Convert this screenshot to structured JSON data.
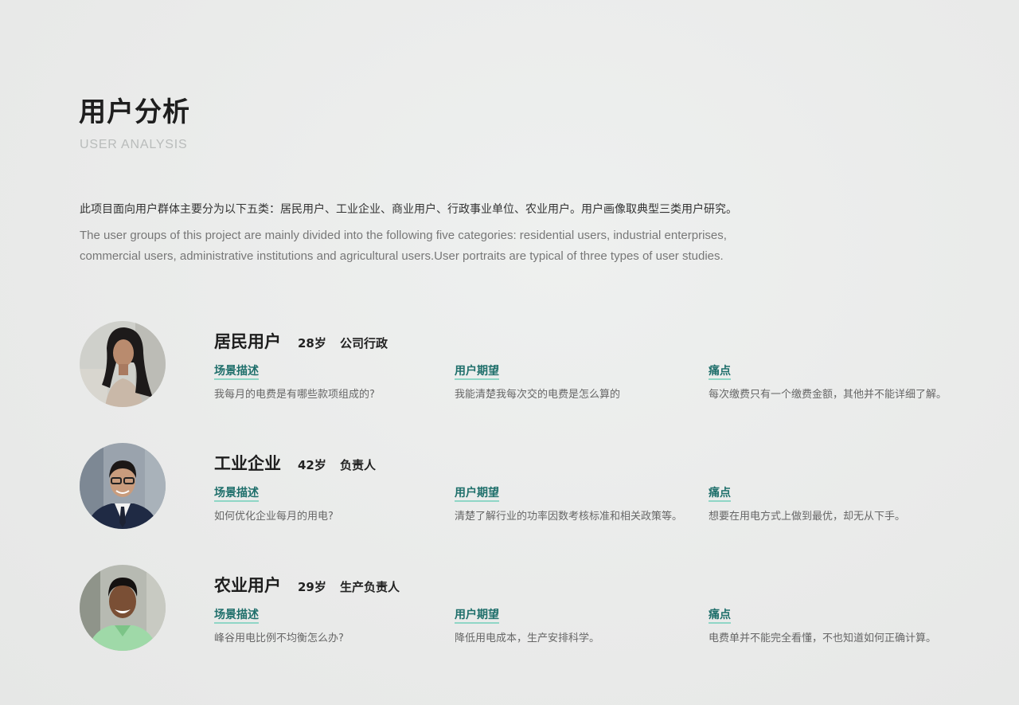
{
  "header": {
    "title": "用户分析",
    "subtitle": "USER ANALYSIS"
  },
  "intro": {
    "cn": "此项目面向用户群体主要分为以下五类：居民用户、工业企业、商业用户、行政事业单位、农业用户。用户画像取典型三类用户研究。",
    "en": "The user groups of this project are mainly divided into the following five categories: residential users, industrial enterprises, commercial users, administrative institutions and agricultural users.User portraits are typical of three types of user studies."
  },
  "column_labels": {
    "scene": "场景描述",
    "expectation": "用户期望",
    "pain": "痛点"
  },
  "users": [
    {
      "name": "居民用户",
      "age": "28岁",
      "role": "公司行政",
      "scene": "我每月的电费是有哪些款项组成的?",
      "expectation": "我能清楚我每次交的电费是怎么算的",
      "pain": "每次缴费只有一个缴费金额，其他并不能详细了解。"
    },
    {
      "name": "工业企业",
      "age": "42岁",
      "role": "负责人",
      "scene": "如何优化企业每月的用电?",
      "expectation": "清楚了解行业的功率因数考核标准和相关政策等。",
      "pain": "想要在用电方式上做到最优，却无从下手。"
    },
    {
      "name": "农业用户",
      "age": "29岁",
      "role": "生产负责人",
      "scene": "峰谷用电比例不均衡怎么办?",
      "expectation": "降低用电成本，生产安排科学。",
      "pain": "电费单并不能完全看懂，不也知道如何正确计算。"
    }
  ]
}
